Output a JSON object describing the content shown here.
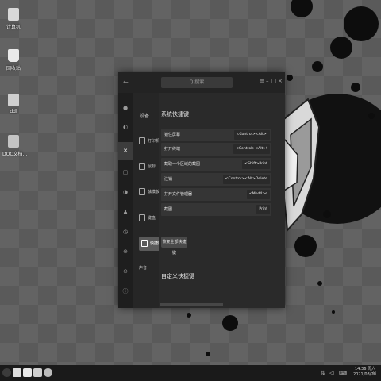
{
  "desktop": {
    "icons": [
      {
        "label": "计算机",
        "icon": "computer-icon"
      },
      {
        "label": "回收站",
        "icon": "trash-icon"
      },
      {
        "label": "ddl",
        "icon": "file-icon"
      },
      {
        "label": "DOC文档...",
        "icon": "document-icon"
      }
    ]
  },
  "window": {
    "search_placeholder": "Q 搜索",
    "back": "←",
    "controls": [
      "≡",
      "–",
      "□",
      "×"
    ],
    "category_title": "设备",
    "side_items": [
      {
        "label": "打印机",
        "active": false
      },
      {
        "label": "鼠标",
        "active": false
      },
      {
        "label": "触摸板",
        "active": false
      },
      {
        "label": "键盘",
        "active": false
      },
      {
        "label": "快捷键",
        "active": true
      },
      {
        "label": "声音",
        "active": false
      }
    ],
    "system_title": "系统快捷键",
    "shortcuts": [
      {
        "name": "锁住屏幕",
        "keys": "<Control><Alt>l"
      },
      {
        "name": "打开终端",
        "keys": "<Control><Alt>t"
      },
      {
        "name": "截取一个区域的截图",
        "keys": "<Shift>Print"
      },
      {
        "name": "注销",
        "keys": "<Control><Alt>Delete"
      },
      {
        "name": "打开文件管理器",
        "keys": "<Mod4>e"
      },
      {
        "name": "截图",
        "keys": "Print"
      }
    ],
    "restore_label": "恢复全部快捷键",
    "custom_title": "自定义快捷键"
  },
  "taskbar": {
    "time": "14:36 周六",
    "date": "2021/03/20"
  },
  "colors": {
    "wallpaper": "#5c5c5c",
    "window_bg": "#262626",
    "row_bg": "#353535",
    "taskbar": "#1a1a1a"
  }
}
